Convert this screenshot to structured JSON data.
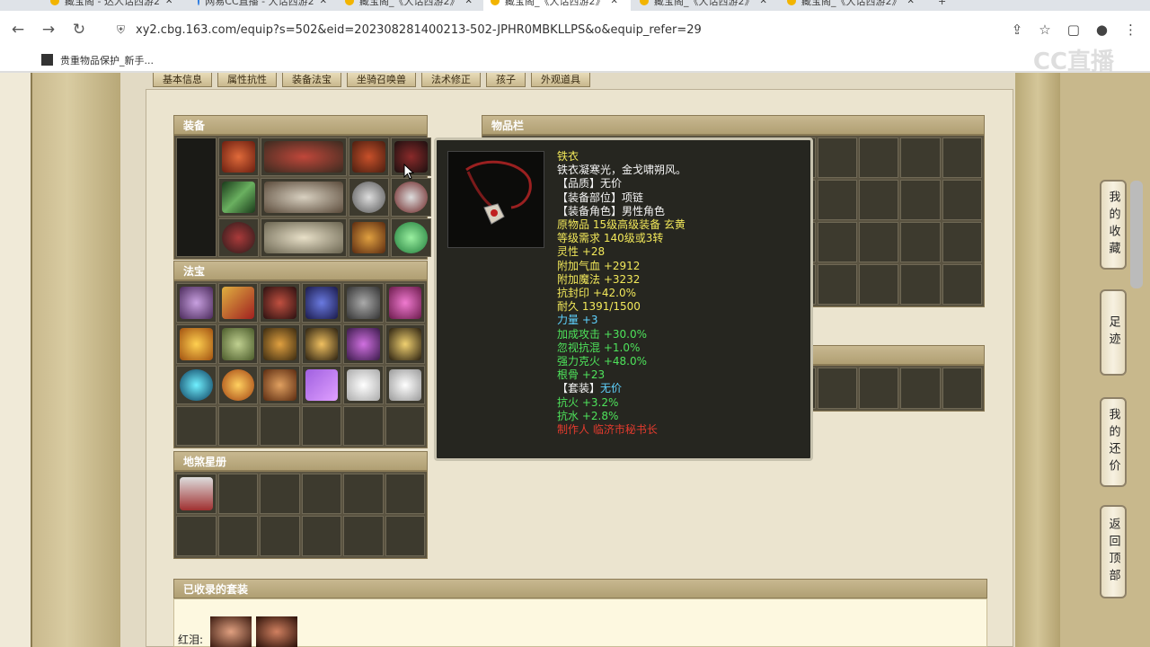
{
  "browser": {
    "tabs": [
      {
        "label": "藏宝阁 - 达人话西游2",
        "active": false
      },
      {
        "label": "网易CC直播 - 大话西游2",
        "active": false
      },
      {
        "label": "藏宝阁_《大话西游2》",
        "active": false
      },
      {
        "label": "藏宝阁_《大话西游2》",
        "active": true
      },
      {
        "label": "藏宝阁_《大话西游2》",
        "active": false
      },
      {
        "label": "藏宝阁_《大话西游2》",
        "active": false
      }
    ],
    "new_tab": "+",
    "url": "xy2.cbg.163.com/equip?s=502&eid=202308281400213-502-JPHR0MBKLLPS&o&equip_refer=29",
    "bookmark": "贵重物品保护_新手...",
    "watermark": "CC直播"
  },
  "page_tabs": [
    "基本信息",
    "属性抗性",
    "装备法宝",
    "坐骑召唤兽",
    "法术修正",
    "孩子",
    "外观道具"
  ],
  "panels": {
    "equipment": "装备",
    "treasure": "法宝",
    "ghost_book": "地煞星册",
    "inventory": "物品栏",
    "sets": "已收录的套装",
    "set_row_label": "红泪:"
  },
  "sidebar": {
    "favorites": "我的收藏",
    "footprint": "足迹",
    "my_bids": "我的还价",
    "back_top": "返回顶部"
  },
  "tooltip": {
    "name": "铁衣",
    "desc": "铁衣凝寒光，金戈啸朔风。",
    "lines": [
      {
        "text": "【品质】无价",
        "color": "w"
      },
      {
        "text": "【装备部位】项链",
        "color": "w"
      },
      {
        "text": "【装备角色】男性角色",
        "color": "w"
      },
      {
        "text": "原物品 15级高级装备 玄黄",
        "color": "y"
      },
      {
        "text": "等级需求 140级或3转",
        "color": "y"
      },
      {
        "text": "灵性 +28",
        "color": "y"
      },
      {
        "text": "附加气血 +2912",
        "color": "y"
      },
      {
        "text": "附加魔法 +3232",
        "color": "y"
      },
      {
        "text": "抗封印 +42.0%",
        "color": "y"
      },
      {
        "text": "耐久 1391/1500",
        "color": "y"
      },
      {
        "text": "力量 +3",
        "color": "c"
      },
      {
        "text": "加成攻击 +30.0%",
        "color": "g"
      },
      {
        "text": "忽视抗混 +1.0%",
        "color": "g"
      },
      {
        "text": "强力克火 +48.0%",
        "color": "g"
      },
      {
        "text": "根骨 +23",
        "color": "g"
      },
      {
        "text": " ",
        "color": "w"
      }
    ],
    "set_label": "【套装】",
    "set_value": "无价",
    "set_lines": [
      {
        "text": "抗火 +3.2%",
        "color": "g"
      },
      {
        "text": "抗水 +2.8%",
        "color": "g"
      }
    ],
    "maker": "制作人 临济市秘书长"
  }
}
